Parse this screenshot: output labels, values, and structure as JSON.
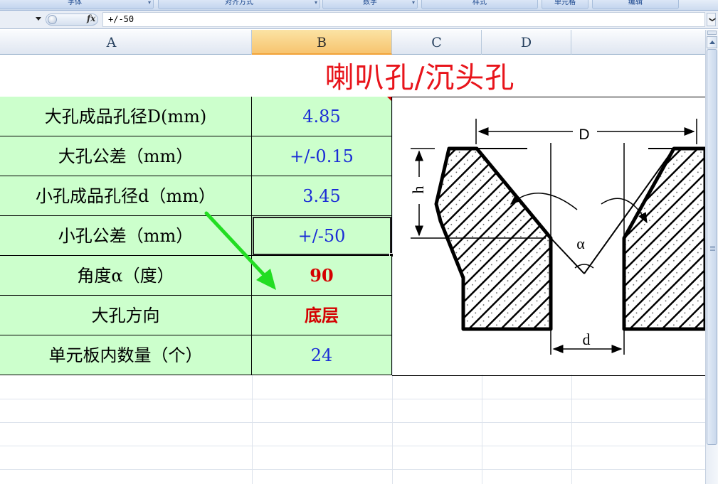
{
  "ribbon": {
    "groups": [
      "字体",
      "对齐方式",
      "数字",
      "样式",
      "单元格",
      "编辑"
    ]
  },
  "formula_bar": {
    "fx_label": "fx",
    "value": "+/-50",
    "expand_glyph": "❯"
  },
  "columns": [
    "A",
    "B",
    "C",
    "D"
  ],
  "active_column": "B",
  "sheet": {
    "title": "喇叭孔/沉头孔",
    "rows": [
      {
        "label": "大孔成品孔径D(mm)",
        "value": "4.85"
      },
      {
        "label": "大孔公差（mm）",
        "value": "+/-0.15"
      },
      {
        "label": "小孔成品孔径d（mm）",
        "value": "3.45"
      },
      {
        "label": "小孔公差（mm）",
        "value": "+/-50"
      },
      {
        "label": "角度α（度）",
        "value": "90"
      },
      {
        "label": "大孔方向",
        "value": "底层"
      },
      {
        "label": "单元板内数量（个）",
        "value": "24"
      }
    ],
    "selected_row": 3,
    "red_rows": [
      4,
      5
    ]
  },
  "diagram": {
    "label_D": "D",
    "label_h": "h",
    "label_alpha": "α",
    "label_d": "d"
  },
  "colors": {
    "cell_fill": "#ccffcc",
    "title_red": "#e8141b",
    "value_blue": "#1a2cd6",
    "value_red": "#d40000",
    "arrow_green": "#22dd22"
  },
  "icons": [
    "namebox-dropdown-icon",
    "fx-icon",
    "expand-formula-icon",
    "scroll-up-icon"
  ]
}
